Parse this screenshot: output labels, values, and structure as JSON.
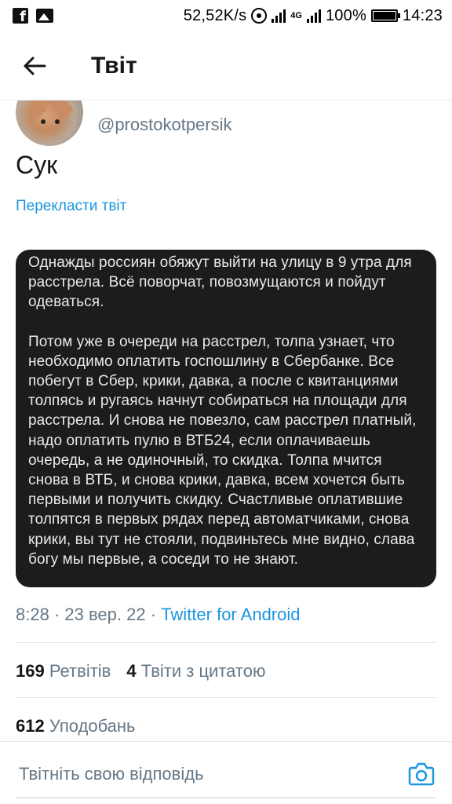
{
  "status_bar": {
    "speed": "52,52K/s",
    "network": "4G",
    "battery": "100%",
    "time": "14:23",
    "icons": [
      "facebook-icon",
      "image-icon",
      "hotspot-icon",
      "signal-icon",
      "battery-icon"
    ]
  },
  "header": {
    "title": "Твіт",
    "back_icon": "arrow-left-icon"
  },
  "author": {
    "handle": "@prostokotpersik"
  },
  "tweet": {
    "text": "Сук",
    "translate_label": "Перекласти твіт",
    "image_paragraphs": [
      "Однажды россиян обяжут выйти на улицу в 9 утра для расстрела. Всё поворчат, повозмущаются и пойдут одеваться.",
      "Потом уже в очереди на расстрел, толпа узнает, что необходимо оплатить госпошлину в Сбербанке. Все побегут в Сбер, крики, давка, а после с квитанциями толпясь и ругаясь начнут собираться на площади для расстрела. И снова не повезло, сам расстрел платный, надо оплатить пулю в ВТБ24, если оплачиваешь очередь, а не одиночный, то скидка. Толпа мчится снова в ВТБ, и снова крики, давка, всем хочется быть первыми и получить скидку. Счастливые оплатившие толпятся в первых рядах перед автоматчиками, снова крики, вы тут не стояли, подвиньтесь мне видно, слава богу мы первые, а соседи то не знают."
    ],
    "time": "8:28",
    "separator": "·",
    "date": "23 вер. 22",
    "source": "Twitter for Android"
  },
  "stats": {
    "retweets_count": "169",
    "retweets_label": "Ретвітів",
    "quotes_count": "4",
    "quotes_label": "Твіти з цитатою",
    "likes_count": "612",
    "likes_label": "Уподобань"
  },
  "reply": {
    "placeholder": "Твітніть свою відповідь",
    "camera_icon": "camera-icon"
  },
  "colors": {
    "accent": "#1b95e0",
    "secondary_text": "#657786",
    "image_background": "#1c1c1e"
  }
}
